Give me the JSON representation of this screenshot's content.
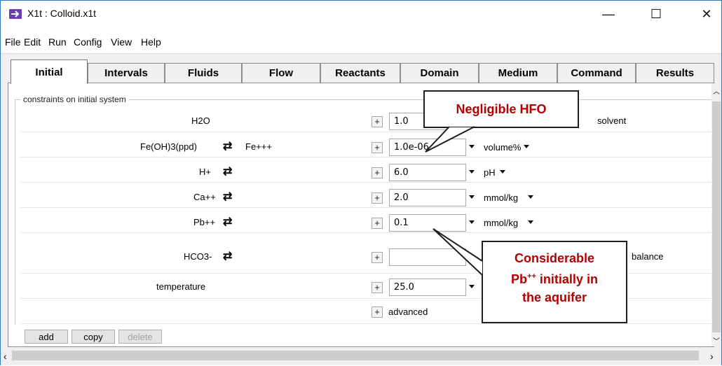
{
  "window": {
    "title": "X1t : Colloid.x1t",
    "minimize": "—",
    "maximize": "☐",
    "close": "✕"
  },
  "menu": [
    "File",
    "Edit",
    "Run",
    "Config",
    "View",
    "Help"
  ],
  "tabs": [
    "Initial",
    "Intervals",
    "Fluids",
    "Flow",
    "Reactants",
    "Domain",
    "Medium",
    "Command",
    "Results"
  ],
  "group_title": "constraints on initial system",
  "rows": [
    {
      "label": "H2O",
      "value": "1.0",
      "unit": "",
      "extra": "solvent"
    },
    {
      "label": "Fe(OH)3(ppd)",
      "swap_with": "Fe+++",
      "value": "1.0e-06",
      "unit": "volume%"
    },
    {
      "label": "H+",
      "value": "6.0",
      "unit": "pH"
    },
    {
      "label": "Ca++",
      "value": "2.0",
      "unit": "mmol/kg"
    },
    {
      "label": "Pb++",
      "value": "0.1",
      "unit": "mmol/kg"
    },
    {
      "label": "HCO3-",
      "value": "",
      "unit": "",
      "extra": "balance"
    },
    {
      "label": "temperature",
      "value": "25.0",
      "unit": ""
    }
  ],
  "advanced": "advanced",
  "buttons": {
    "add": "add",
    "copy": "copy",
    "delete": "delete"
  },
  "callouts": {
    "hfo": "Negligible HFO",
    "pb_line1": "Considerable",
    "pb_line2_pre": "Pb",
    "pb_line2_sup": "++",
    "pb_line2_post": " initially in",
    "pb_line3": "the aquifer"
  },
  "colors": {
    "callout_text": "#b30000",
    "window_border": "#2b79c7"
  },
  "icons": {
    "swap": "swap-arrows-icon",
    "plus": "plus-icon",
    "dropdown": "dropdown-triangle-icon"
  }
}
